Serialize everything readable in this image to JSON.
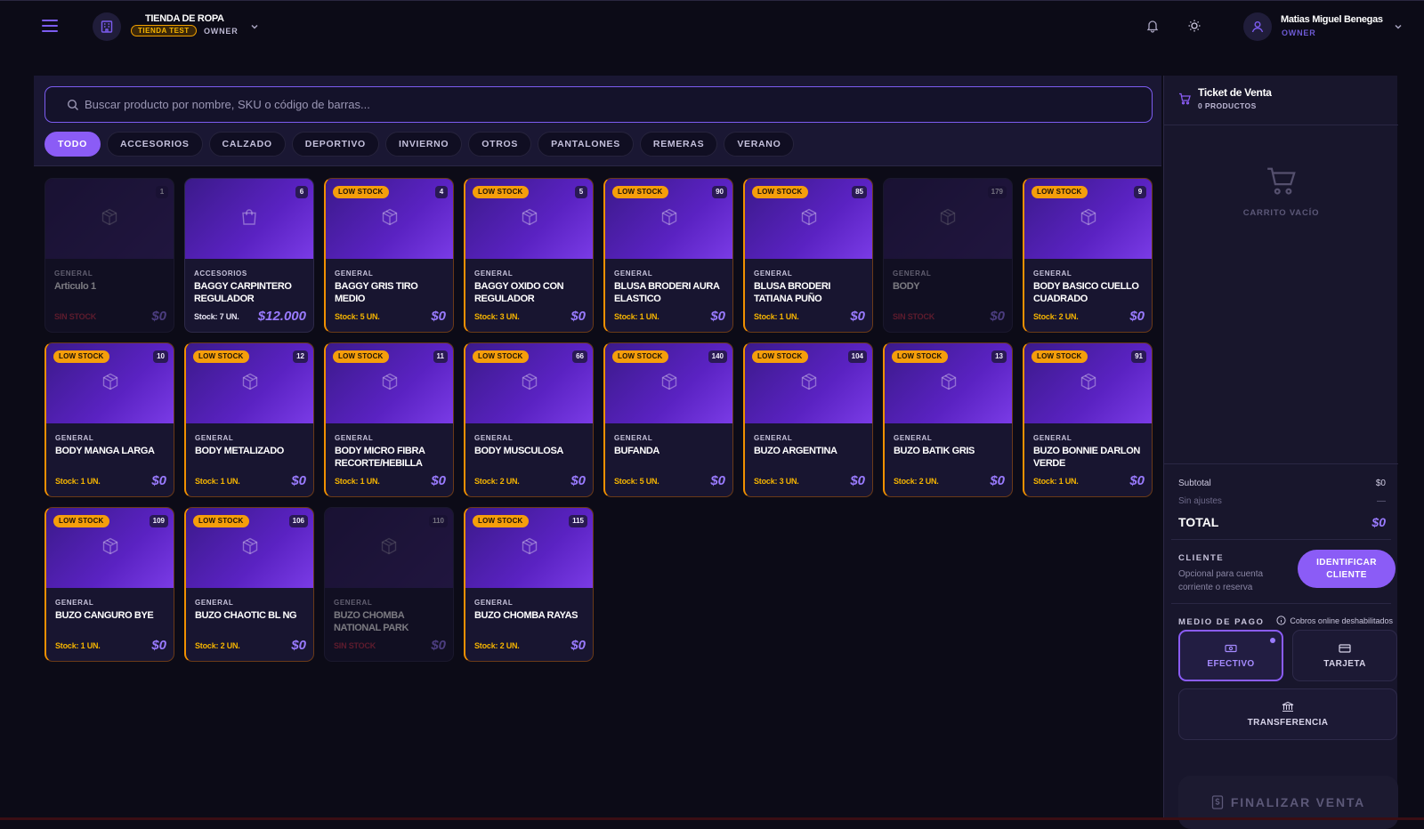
{
  "header": {
    "store_name": "TIENDA DE ROPA",
    "store_badge": "TIENDA TEST",
    "store_role": "OWNER",
    "user_name": "Matias Miguel Benegas",
    "user_role": "OWNER",
    "icons": [
      "menu-icon",
      "store-icon",
      "chevron-down-icon",
      "bell-icon",
      "sun-icon",
      "user-icon"
    ]
  },
  "search": {
    "placeholder": "Buscar producto por nombre, SKU o código de barras...",
    "value": ""
  },
  "categories": [
    "TODO",
    "ACCESORIOS",
    "CALZADO",
    "DEPORTIVO",
    "INVIERNO",
    "OTROS",
    "PANTALONES",
    "REMERAS",
    "VERANO"
  ],
  "active_category": "TODO",
  "products": [
    {
      "id": "1",
      "category": "GENERAL",
      "name": "Articulo 1",
      "stock": "SIN STOCK",
      "price": "$0",
      "low": false,
      "out": true
    },
    {
      "id": "6",
      "category": "ACCESORIOS",
      "name": "BAGGY CARPINTERO REGULADOR",
      "stock": "Stock: 7 UN.",
      "price": "$12.000",
      "low": false,
      "out": false
    },
    {
      "id": "4",
      "category": "GENERAL",
      "name": "BAGGY GRIS TIRO MEDIO",
      "stock": "Stock: 5 UN.",
      "price": "$0",
      "low": true,
      "out": false
    },
    {
      "id": "5",
      "category": "GENERAL",
      "name": "BAGGY OXIDO CON REGULADOR",
      "stock": "Stock: 3 UN.",
      "price": "$0",
      "low": true,
      "out": false
    },
    {
      "id": "90",
      "category": "GENERAL",
      "name": "BLUSA BRODERI AURA ELASTICO",
      "stock": "Stock: 1 UN.",
      "price": "$0",
      "low": true,
      "out": false
    },
    {
      "id": "85",
      "category": "GENERAL",
      "name": "BLUSA BRODERI TATIANA PUÑO",
      "stock": "Stock: 1 UN.",
      "price": "$0",
      "low": true,
      "out": false
    },
    {
      "id": "179",
      "category": "GENERAL",
      "name": "BODY",
      "stock": "SIN STOCK",
      "price": "$0",
      "low": false,
      "out": true
    },
    {
      "id": "9",
      "category": "GENERAL",
      "name": "BODY BASICO CUELLO CUADRADO",
      "stock": "Stock: 2 UN.",
      "price": "$0",
      "low": true,
      "out": false
    },
    {
      "id": "10",
      "category": "GENERAL",
      "name": "BODY MANGA LARGA",
      "stock": "Stock: 1 UN.",
      "price": "$0",
      "low": true,
      "out": false
    },
    {
      "id": "12",
      "category": "GENERAL",
      "name": "BODY METALIZADO",
      "stock": "Stock: 1 UN.",
      "price": "$0",
      "low": true,
      "out": false
    },
    {
      "id": "11",
      "category": "GENERAL",
      "name": "BODY MICRO FIBRA RECORTE/HEBILLA",
      "stock": "Stock: 1 UN.",
      "price": "$0",
      "low": true,
      "out": false
    },
    {
      "id": "66",
      "category": "GENERAL",
      "name": "BODY MUSCULOSA",
      "stock": "Stock: 2 UN.",
      "price": "$0",
      "low": true,
      "out": false
    },
    {
      "id": "140",
      "category": "GENERAL",
      "name": "BUFANDA",
      "stock": "Stock: 5 UN.",
      "price": "$0",
      "low": true,
      "out": false
    },
    {
      "id": "104",
      "category": "GENERAL",
      "name": "BUZO ARGENTINA",
      "stock": "Stock: 3 UN.",
      "price": "$0",
      "low": true,
      "out": false
    },
    {
      "id": "13",
      "category": "GENERAL",
      "name": "BUZO BATIK GRIS",
      "stock": "Stock: 2 UN.",
      "price": "$0",
      "low": true,
      "out": false
    },
    {
      "id": "91",
      "category": "GENERAL",
      "name": "BUZO BONNIE DARLON VERDE",
      "stock": "Stock: 1 UN.",
      "price": "$0",
      "low": true,
      "out": false
    },
    {
      "id": "109",
      "category": "GENERAL",
      "name": "BUZO CANGURO BYE",
      "stock": "Stock: 1 UN.",
      "price": "$0",
      "low": true,
      "out": false
    },
    {
      "id": "106",
      "category": "GENERAL",
      "name": "BUZO CHAOTIC BL NG",
      "stock": "Stock: 2 UN.",
      "price": "$0",
      "low": true,
      "out": false
    },
    {
      "id": "110",
      "category": "GENERAL",
      "name": "BUZO CHOMBA NATIONAL PARK",
      "stock": "SIN STOCK",
      "price": "$0",
      "low": false,
      "out": true
    },
    {
      "id": "115",
      "category": "GENERAL",
      "name": "BUZO CHOMBA RAYAS",
      "stock": "Stock: 2 UN.",
      "price": "$0",
      "low": true,
      "out": false
    }
  ],
  "labels": {
    "low_stock": "LOW STOCK"
  },
  "ticket": {
    "title": "Ticket de Venta",
    "count": "0 PRODUCTOS",
    "empty_label": "CARRITO VACÍO",
    "subtotal_label": "Subtotal",
    "subtotal_value": "$0",
    "adjust_label": "Sin ajustes",
    "adjust_value": "—",
    "total_label": "TOTAL",
    "total_value": "$0",
    "client_title": "CLIENTE",
    "client_desc": "Opcional para cuenta corriente o reserva",
    "identify_button": "IDENTIFICAR CLIENTE",
    "payment_title": "MEDIO DE PAGO",
    "payment_note": "Cobros online deshabilitados",
    "pay_cash": "EFECTIVO",
    "pay_card": "TARJETA",
    "pay_transfer": "TRANSFERENCIA",
    "finalize_button": "FINALIZAR VENTA"
  },
  "colors": {
    "accent": "#8b5cf6",
    "low_stock": "#f59e0b",
    "out_stock": "#c03048",
    "background": "#0c0b17"
  }
}
